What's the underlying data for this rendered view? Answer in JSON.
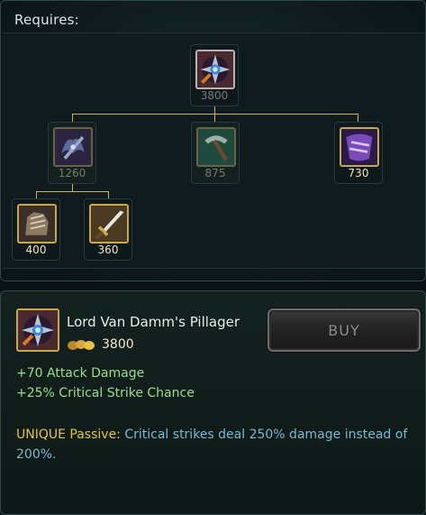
{
  "requires_label": "Requires:",
  "tree": {
    "root": {
      "icon": "pillager-icon",
      "cost": "3800",
      "state": "selected"
    },
    "children": [
      {
        "icon": "bat-axe-icon",
        "cost": "1260",
        "state": "faded"
      },
      {
        "icon": "pickaxe-icon",
        "cost": "875",
        "state": "faded"
      },
      {
        "icon": "cloak-icon",
        "cost": "730",
        "state": "owned"
      }
    ],
    "grandchildren": [
      {
        "icon": "gauntlet-icon",
        "cost": "400",
        "state": "owned"
      },
      {
        "icon": "long-sword-icon",
        "cost": "360",
        "state": "owned"
      }
    ]
  },
  "item": {
    "icon": "pillager-icon",
    "name": "Lord Van Damm's Pillager",
    "cost": "3800",
    "buy_label": "BUY",
    "stats": [
      "+70 Attack Damage",
      "+25% Critical Strike Chance"
    ],
    "passive_label": "UNIQUE Passive:",
    "passive_text": " Critical strikes deal 250% damage instead of 200%."
  },
  "colors": {
    "connector": "#c9b458",
    "stat_green": "#96e08a",
    "unique_gold": "#e6c43a",
    "passive_blue": "#7ab9cf"
  }
}
